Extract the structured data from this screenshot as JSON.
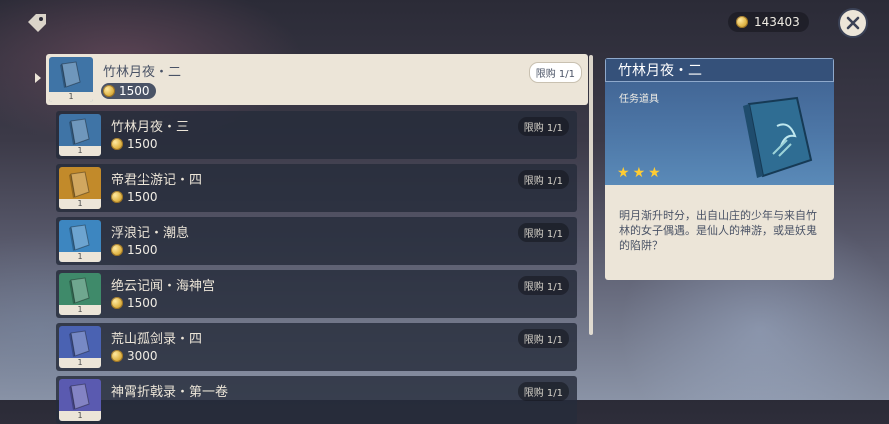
{
  "currency": {
    "amount": "143403",
    "icon": "mora-coin-icon"
  },
  "items": [
    {
      "name": "竹林月夜・二",
      "price": "1500",
      "limit": "限购 1/1",
      "count": "1",
      "color": "#3f74a6",
      "selected": true
    },
    {
      "name": "竹林月夜・三",
      "price": "1500",
      "limit": "限购 1/1",
      "count": "1",
      "color": "#3f74a6"
    },
    {
      "name": "帝君尘游记・四",
      "price": "1500",
      "limit": "限购 1/1",
      "count": "1",
      "color": "#c28a2a"
    },
    {
      "name": "浮浪记・潮息",
      "price": "1500",
      "limit": "限购 1/1",
      "count": "1",
      "color": "#3d86c0"
    },
    {
      "name": "绝云记闻・海神宫",
      "price": "1500",
      "limit": "限购 1/1",
      "count": "1",
      "color": "#3f8a6a"
    },
    {
      "name": "荒山孤剑录・四",
      "price": "3000",
      "limit": "限购 1/1",
      "count": "1",
      "color": "#4a62b2"
    },
    {
      "name": "神霄折戟录・第一卷",
      "price": "",
      "limit": "限购 1/1",
      "count": "1",
      "color": "#5a5ab0"
    }
  ],
  "detail": {
    "title": "竹林月夜・二",
    "type": "任务道具",
    "stars": 3,
    "description": "明月渐升时分，出自山庄的少年与来自竹林的女子偶遇。是仙人的神游，或是妖鬼的陷阱？"
  }
}
